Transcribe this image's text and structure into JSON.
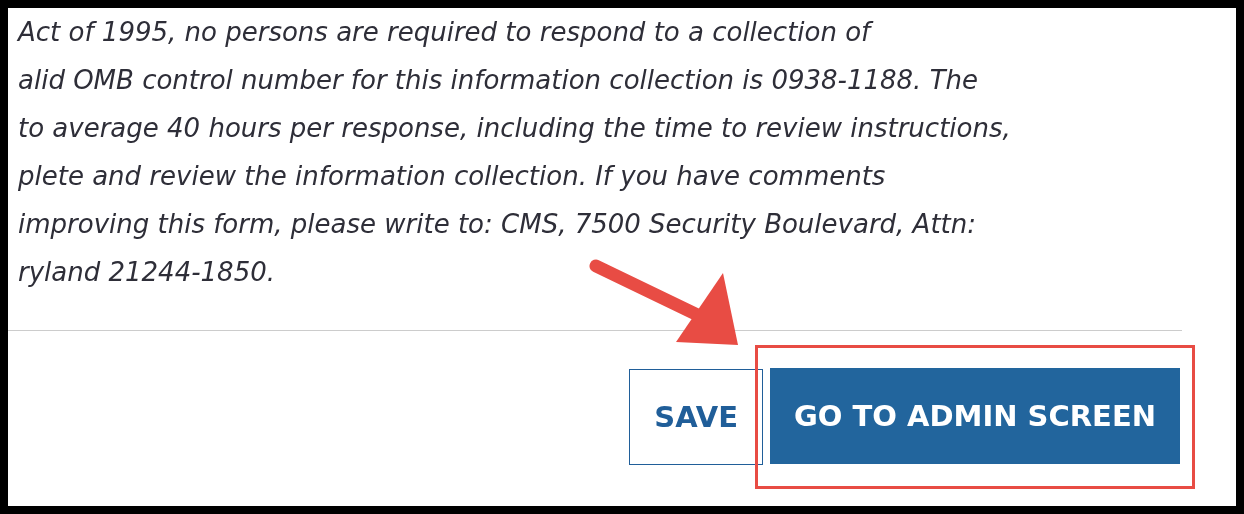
{
  "paragraph_lines": [
    "Act of 1995, no persons are required to respond to a collection of",
    "alid OMB control number for this information collection is 0938-1188. The",
    "to average 40 hours per response, including the time to review instructions,",
    "plete and review the information collection. If you have comments",
    "improving this form, please write to: CMS, 7500 Security Boulevard, Attn:",
    "ryland 21244-1850."
  ],
  "buttons": [
    {
      "label": "SAVE",
      "kind": "outline",
      "highlighted": false
    },
    {
      "label": "GO TO ADMIN SCREEN",
      "kind": "primary",
      "highlighted": true
    }
  ]
}
